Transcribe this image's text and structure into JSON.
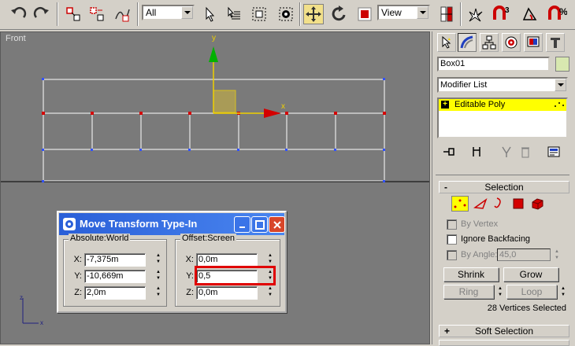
{
  "toolbar": {
    "selection_filter": "All",
    "ref_coord": "View",
    "snap_angle_label": "3",
    "percent_snap_label": "%"
  },
  "viewport": {
    "label": "Front",
    "axis_x": "x",
    "axis_y": "y"
  },
  "dialog": {
    "title": "Move Transform Type-In",
    "absolute": {
      "title": "Absolute:World",
      "x_label": "X:",
      "x_value": "-7,375m",
      "y_label": "Y:",
      "y_value": "-10,669m",
      "z_label": "Z:",
      "z_value": "2,0m"
    },
    "offset": {
      "title": "Offset:Screen",
      "x_label": "X:",
      "x_value": "0,0m",
      "y_label": "Y:",
      "y_value": "0,5",
      "z_label": "Z:",
      "z_value": "0,0m"
    }
  },
  "panel": {
    "object_name": "Box01",
    "modifier_list": "Modifier List",
    "stack_item": "Editable Poly",
    "selection_rollout": "Selection",
    "by_vertex": "By Vertex",
    "ignore_backfacing": "Ignore Backfacing",
    "by_angle": "By Angle:",
    "by_angle_value": "45,0",
    "shrink": "Shrink",
    "grow": "Grow",
    "ring": "Ring",
    "loop": "Loop",
    "status": "28 Vertices Selected",
    "soft_selection_rollout": "Soft Selection"
  },
  "colors": {
    "accent_yellow": "#ffff00",
    "selection_red": "#cc0000",
    "title_blue": "#2a5fd8"
  }
}
